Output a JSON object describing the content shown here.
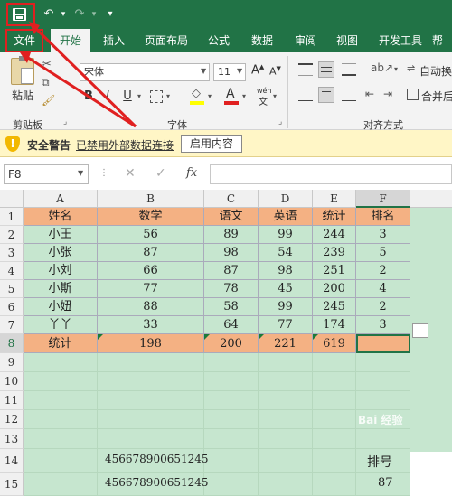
{
  "qat": {
    "save_icon": "save-icon",
    "undo_icon": "undo-icon",
    "redo_icon": "redo-icon",
    "customize_icon": "chevron-down-icon"
  },
  "tabs": [
    "文件",
    "开始",
    "插入",
    "页面布局",
    "公式",
    "数据",
    "审阅",
    "视图",
    "开发工具",
    "帮"
  ],
  "ribbon": {
    "clipboard": {
      "paste_label": "粘贴",
      "group_label": "剪贴板"
    },
    "font": {
      "font_name": "宋体",
      "font_size": "11",
      "bold": "B",
      "italic": "I",
      "underline": "U",
      "wen": "wén",
      "group_label": "字体",
      "font_color": "#e02020",
      "fill_color": "#ffff00"
    },
    "alignment": {
      "wrap_label": "自动换",
      "merge_label": "合并后",
      "group_label": "对齐方式"
    }
  },
  "security": {
    "title": "安全警告",
    "message": "已禁用外部数据连接",
    "button": "启用内容"
  },
  "formula_bar": {
    "name_box": "F8",
    "fx": "fx",
    "value": ""
  },
  "columns": [
    "A",
    "B",
    "C",
    "D",
    "E",
    "F"
  ],
  "rows": [
    [
      "姓名",
      "数学",
      "语文",
      "英语",
      "统计",
      "排名"
    ],
    [
      "小王",
      "56",
      "89",
      "99",
      "244",
      "3"
    ],
    [
      "小张",
      "87",
      "98",
      "54",
      "239",
      "5"
    ],
    [
      "小刘",
      "66",
      "87",
      "98",
      "251",
      "2"
    ],
    [
      "小斯",
      "77",
      "78",
      "45",
      "200",
      "4"
    ],
    [
      "小妞",
      "88",
      "58",
      "99",
      "245",
      "2"
    ],
    [
      "丫丫",
      "33",
      "64",
      "77",
      "174",
      "3"
    ],
    [
      "统计",
      "198",
      "200",
      "221",
      "619",
      ""
    ]
  ],
  "row_numbers": [
    "1",
    "2",
    "3",
    "4",
    "5",
    "6",
    "7",
    "8",
    "9",
    "10",
    "11",
    "12",
    "13",
    "14",
    "15"
  ],
  "extra": {
    "b14": "456678900651245",
    "b15": "456678900651245",
    "f14": "排号",
    "f15": "87"
  },
  "watermark": "Bai 经验"
}
